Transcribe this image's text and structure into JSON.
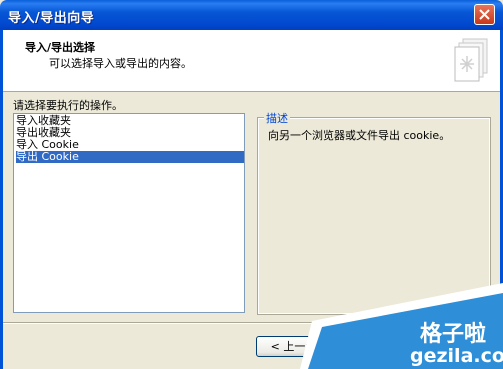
{
  "window": {
    "title": "导入/导出向导"
  },
  "header": {
    "title": "导入/导出选择",
    "subtitle": "可以选择导入或导出的内容。",
    "icon": "wizard-page-icon"
  },
  "actions": {
    "label": "请选择要执行的操作。",
    "items": [
      {
        "label": "导入收藏夹",
        "selected": false
      },
      {
        "label": "导出收藏夹",
        "selected": false
      },
      {
        "label": "导入 Cookie",
        "selected": false
      },
      {
        "label": "导出 Cookie",
        "selected": true
      }
    ]
  },
  "description": {
    "title": "描述",
    "text": "向另一个浏览器或文件导出 cookie。"
  },
  "buttons": {
    "back": "< 上一步"
  },
  "watermark": {
    "line1": "格子啦",
    "line2": "gezila.com"
  },
  "colors": {
    "titlebar": "#0454d8",
    "selection": "#316ac5",
    "dialog_bg": "#ece9d8",
    "group_title": "#0046d5"
  }
}
